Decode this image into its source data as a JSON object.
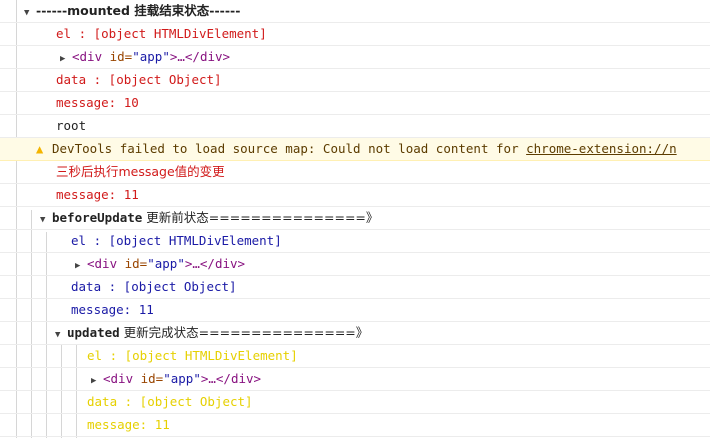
{
  "header": {
    "label": "------mounted 挂载结束状态------"
  },
  "mounted": {
    "el_line": "el     : [object HTMLDivElement]",
    "div_prefix": "<div",
    "div_attr": " id=",
    "div_val": "\"app\"",
    "div_suffix": ">…</div>",
    "data_line": "data   : [object Object]",
    "message_line": "message: 10",
    "root_line": "root"
  },
  "warning": {
    "text": "DevTools failed to load source map: Could not load content for ",
    "link": "chrome-extension://n"
  },
  "log": {
    "delay_text": "三秒后执行message值的变更",
    "message_line": "message: 11"
  },
  "before_update": {
    "title": "beforeUpdate",
    "subtitle": " 更新前状态===============》",
    "el_line": "el     : [object HTMLDivElement]",
    "div_prefix": "<div",
    "div_attr": " id=",
    "div_val": "\"app\"",
    "div_suffix": ">…</div>",
    "data_line": "data   : [object Object]",
    "message_line": "message: 11"
  },
  "updated": {
    "title": "updated",
    "subtitle": " 更新完成状态===============》",
    "el_line": "el     : [object HTMLDivElement]",
    "div_prefix": "<div",
    "div_attr": " id=",
    "div_val": "\"app\"",
    "div_suffix": ">…</div>",
    "data_line": "data   : [object Object]",
    "message_line": "message: 11"
  },
  "icons": {
    "expand": "triangle-down-icon",
    "collapse": "triangle-right-icon",
    "warning": "warning-icon"
  },
  "colors": {
    "mounted_text": "#d11a1a",
    "before_update_text": "#1a1aa6",
    "updated_text": "#e6d000",
    "warning_bg": "#fffbe6"
  }
}
